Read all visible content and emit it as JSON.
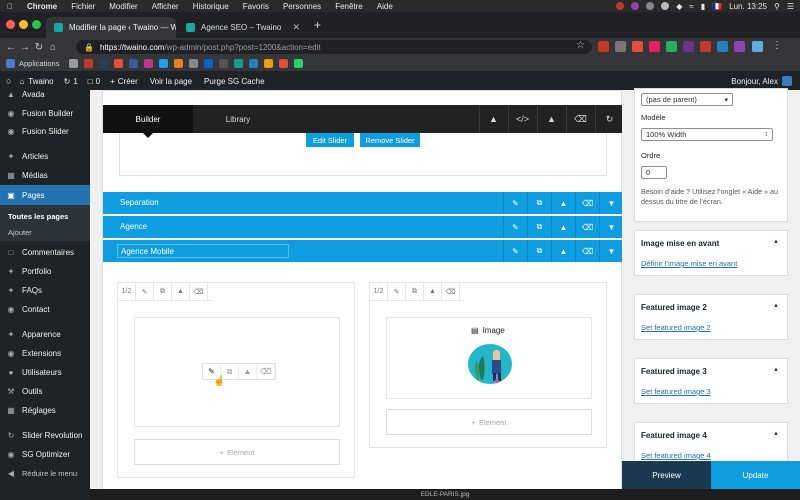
{
  "menubar": {
    "apple_icon": "apple-icon",
    "items": [
      "Chrome",
      "Fichier",
      "Modifier",
      "Afficher",
      "Historique",
      "Favoris",
      "Personnes",
      "Fenêtre",
      "Aide"
    ],
    "language": "🇫🇷",
    "datetime": "Lun. 13:25"
  },
  "browser": {
    "tabs": [
      {
        "title": "Modifier la page ‹ Twaino — W",
        "active": true
      },
      {
        "title": "Agence SEO – Twaino",
        "active": false
      }
    ],
    "new_tab": "+",
    "url_host": "https://twaino.com",
    "url_path": "/wp-admin/post.php?post=1200&action=edit"
  },
  "bookmarks": {
    "label": "Applications"
  },
  "adminbar": {
    "site": "Twaino",
    "updates": "1",
    "comments": "0",
    "new": "Créer",
    "view": "Voir la page",
    "purge": "Purge SG Cache",
    "greeting": "Bonjour, Alex"
  },
  "sidebar": {
    "items": [
      {
        "label": "Avada",
        "icon": "avada-icon"
      },
      {
        "label": "Fusion Builder",
        "icon": "fusion-builder-icon"
      },
      {
        "label": "Fusion Slider",
        "icon": "fusion-slider-icon"
      },
      {
        "label": "Articles",
        "icon": "pin-icon"
      },
      {
        "label": "Médias",
        "icon": "media-icon"
      },
      {
        "label": "Pages",
        "icon": "pages-icon"
      },
      {
        "label": "Commentaires",
        "icon": "comment-icon"
      },
      {
        "label": "Portfolio",
        "icon": "portfolio-icon"
      },
      {
        "label": "FAQs",
        "icon": "faq-icon"
      },
      {
        "label": "Contact",
        "icon": "contact-icon"
      },
      {
        "label": "Apparence",
        "icon": "appearance-icon"
      },
      {
        "label": "Extensions",
        "icon": "plugin-icon"
      },
      {
        "label": "Utilisateurs",
        "icon": "users-icon"
      },
      {
        "label": "Outils",
        "icon": "tools-icon"
      },
      {
        "label": "Réglages",
        "icon": "settings-icon"
      },
      {
        "label": "Slider Revolution",
        "icon": "slider-revolution-icon"
      },
      {
        "label": "SG Optimizer",
        "icon": "sg-optimizer-icon"
      },
      {
        "label": "Réduire le menu",
        "icon": "collapse-icon"
      }
    ],
    "sub_all": "Toutes les pages",
    "sub_add": "Ajouter"
  },
  "builder": {
    "tab_builder": "Builder",
    "tab_library": "Library",
    "edit_slider": "Edit Slider",
    "remove_slider": "Remove Slider",
    "rows": [
      "Separation",
      "Agence",
      "Agence Mobile"
    ],
    "col_size_1": "1/2",
    "col_size_2": "1/2",
    "element_label": "Image",
    "add_element_1": "Element",
    "add_element_2": "Element"
  },
  "rightpanel": {
    "parent_select": "(pas de parent)",
    "model_label": "Modèle",
    "model_select": "100% Width",
    "order_label": "Ordre",
    "order_value": "0",
    "help_text": "Besoin d’aide ? Utilisez l’onglet « Aide » au dessus du titre de l’écran.",
    "featured_title": "Image mise en avant",
    "featured_link": "Définir l’image mise en avant",
    "fi2_title": "Featured image 2",
    "fi2_link": "Set featured image 2",
    "fi3_title": "Featured image 3",
    "fi3_link": "Set featured image 3",
    "fi4_title": "Featured image 4",
    "fi4_link": "Set featured image 4",
    "preview": "Preview",
    "update": "Update"
  },
  "dock": {
    "file": "EDLE-PARIS.jpg"
  },
  "colors": {
    "wp_blue": "#2271b1",
    "fusion_blue": "#0e9de0",
    "admin_dark": "#1d2327"
  }
}
